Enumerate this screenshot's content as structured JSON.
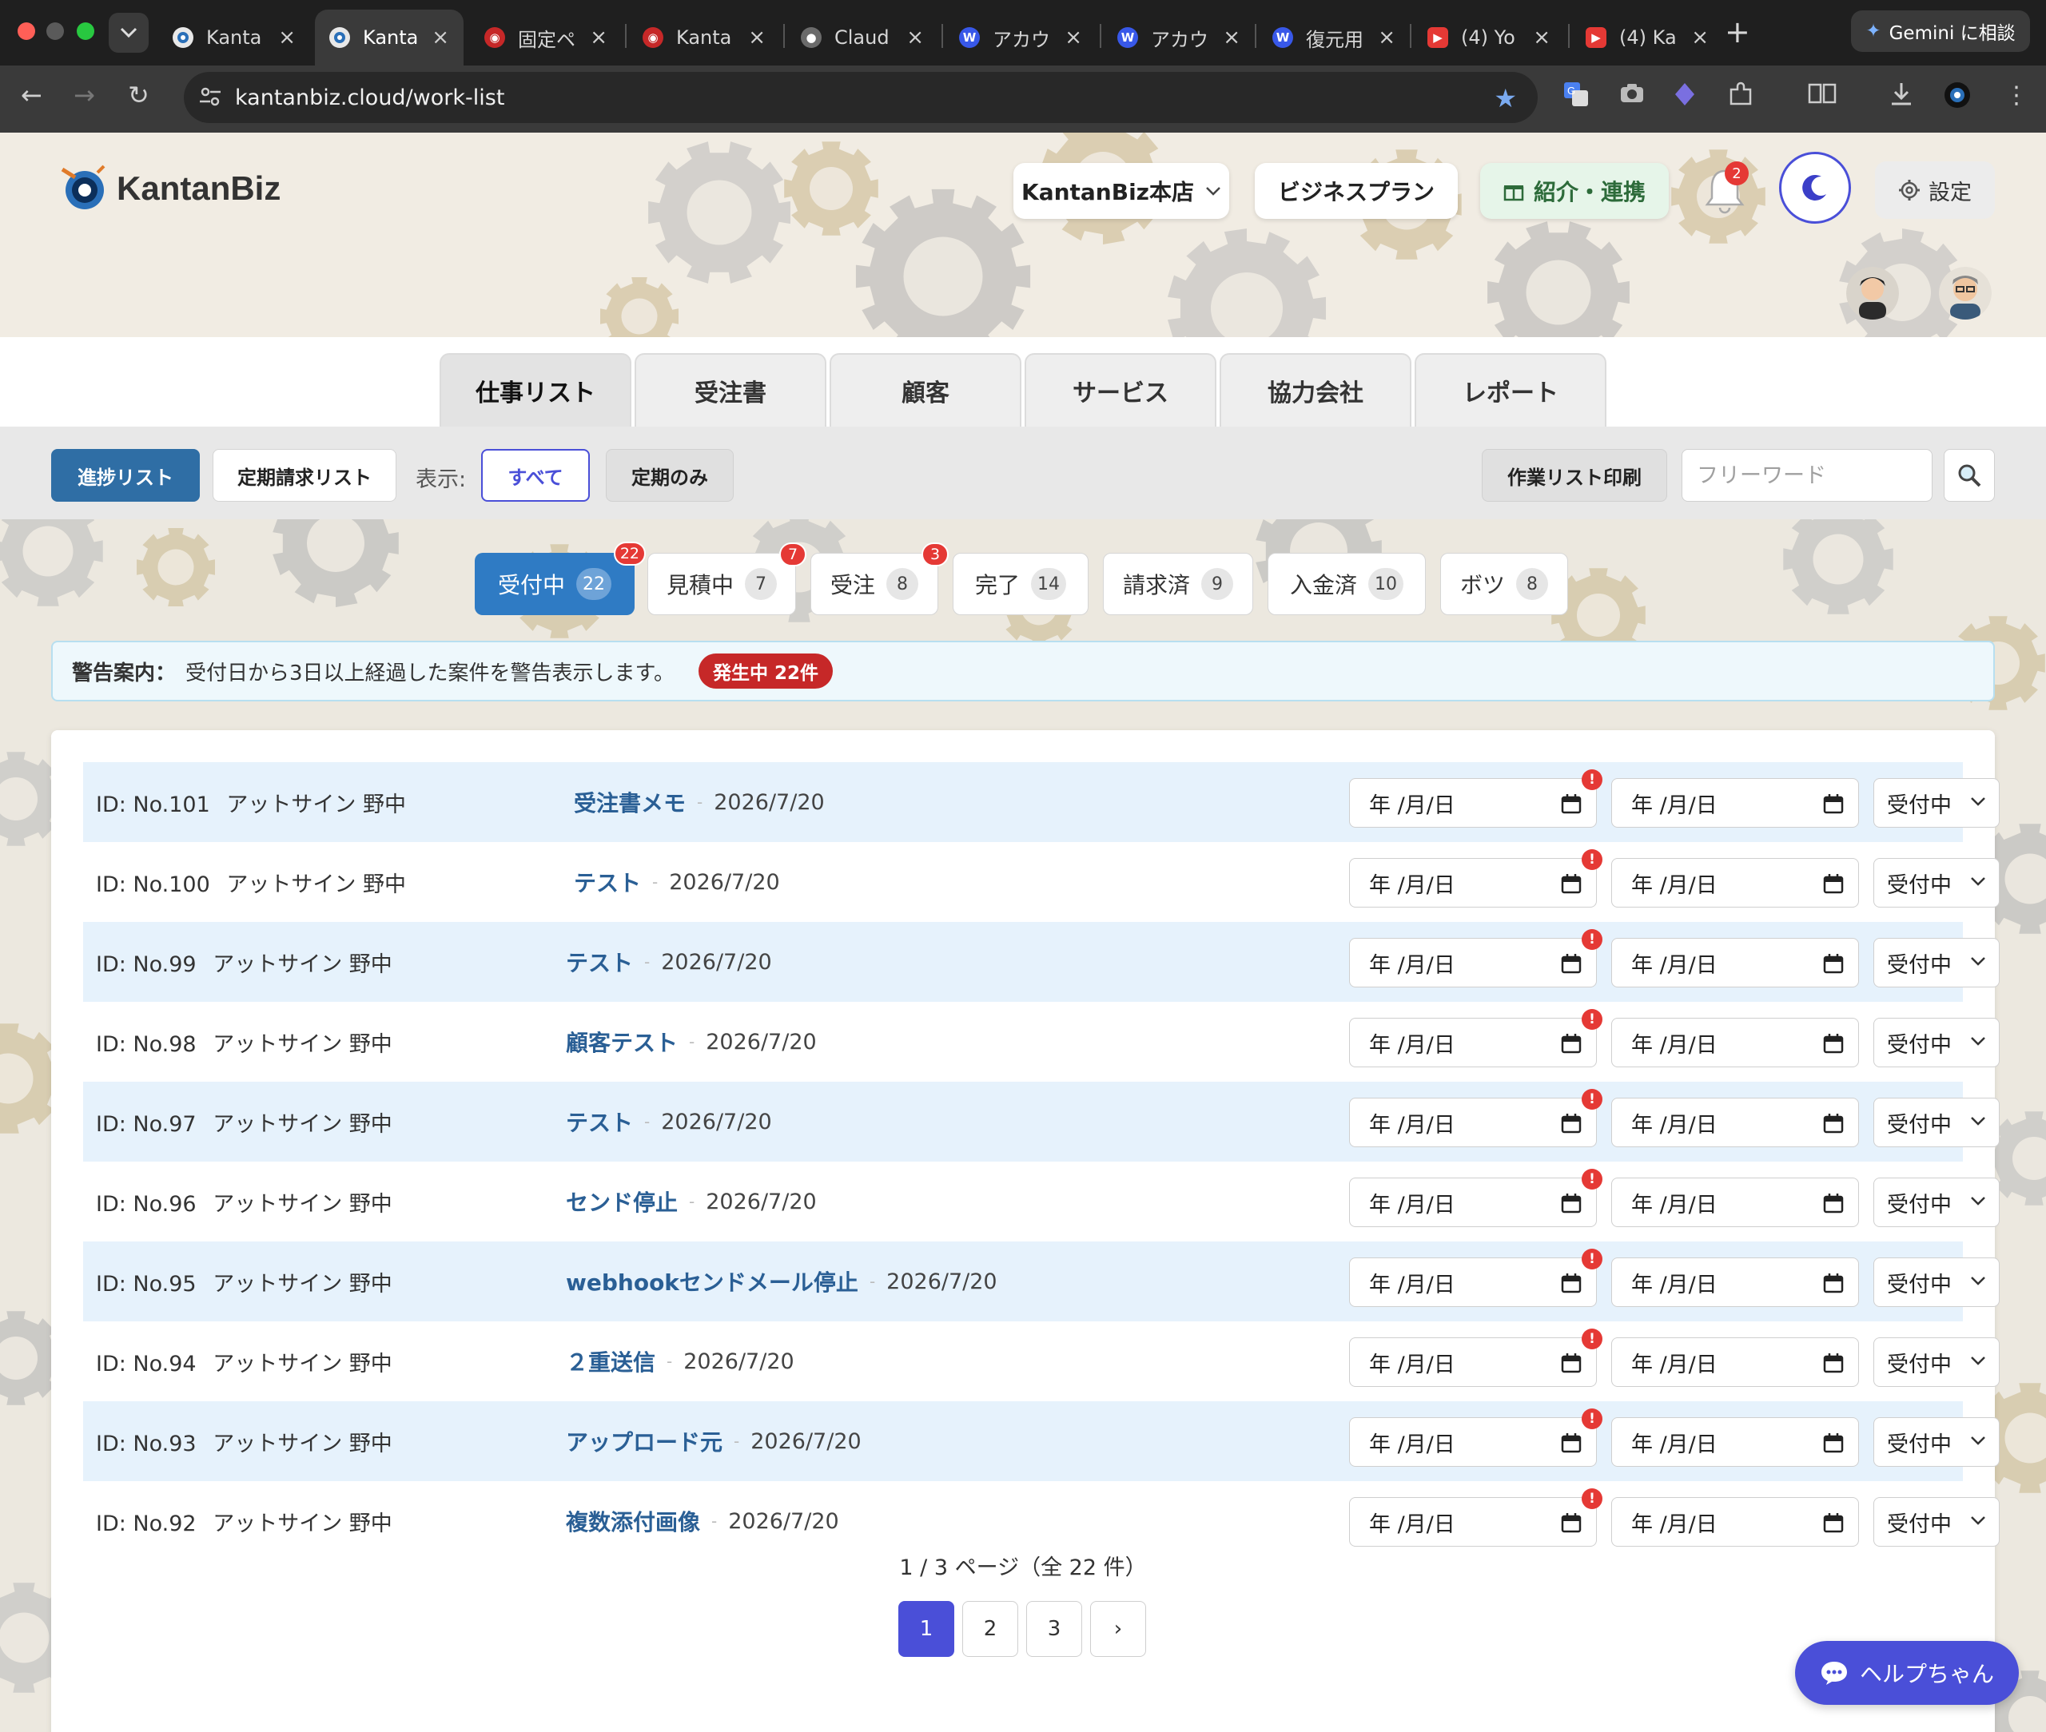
{
  "browser": {
    "tabs": [
      {
        "label": "Kanta",
        "favicon_color": "#3a3a3a",
        "active": false
      },
      {
        "label": "Kanta",
        "favicon_color": "#3a3a3a",
        "active": true
      },
      {
        "label": "固定ペ",
        "favicon_color": "#c62828",
        "active": false
      },
      {
        "label": "Kanta",
        "favicon_color": "#c62828",
        "active": false
      },
      {
        "label": "Claud",
        "favicon_color": "#6b6b6b",
        "active": false
      },
      {
        "label": "アカウ",
        "favicon_color": "#3858e9",
        "active": false
      },
      {
        "label": "アカウ",
        "favicon_color": "#3858e9",
        "active": false
      },
      {
        "label": "復元用",
        "favicon_color": "#3858e9",
        "active": false
      },
      {
        "label": "(4) Yo",
        "favicon_color": "#e53935",
        "active": false
      },
      {
        "label": "(4) Ka",
        "favicon_color": "#e53935",
        "active": false
      }
    ],
    "gemini_label": "Gemini に相談",
    "url": "kantanbiz.cloud/work-list"
  },
  "header": {
    "logo_text": "KantanBiz",
    "store_label": "KantanBiz本店",
    "plan_label": "ビジネスプラン",
    "referral_label": "紹介・連携",
    "notification_count": "2",
    "settings_label": "設定"
  },
  "nav": {
    "tabs": [
      "仕事リスト",
      "受注書",
      "顧客",
      "サービス",
      "協力会社",
      "レポート"
    ]
  },
  "toolbar": {
    "progress_label": "進捗リスト",
    "periodic_label": "定期請求リスト",
    "display_label": "表示:",
    "all_label": "すべて",
    "periodic_only_label": "定期のみ",
    "print_label": "作業リスト印刷",
    "search_placeholder": "フリーワード"
  },
  "status_tabs": [
    {
      "label": "受付中",
      "count": "22",
      "alert": "22"
    },
    {
      "label": "見積中",
      "count": "7",
      "alert": "7"
    },
    {
      "label": "受注",
      "count": "8",
      "alert": "3"
    },
    {
      "label": "完了",
      "count": "14",
      "alert": ""
    },
    {
      "label": "請求済",
      "count": "9",
      "alert": ""
    },
    {
      "label": "入金済",
      "count": "10",
      "alert": ""
    },
    {
      "label": "ボツ",
      "count": "8",
      "alert": ""
    }
  ],
  "warning": {
    "title": "警告案内：",
    "text": "受付日から3日以上経過した案件を警告表示します。",
    "badge": "発生中 22件"
  },
  "rows": [
    {
      "id": "ID: No.101",
      "client": "アットサイン 野中",
      "title": "受注書メモ",
      "date": "2026/7/20",
      "start": "年 /月/日",
      "end": "年 /月/日",
      "status": "受付中"
    },
    {
      "id": "ID: No.100",
      "client": "アットサイン 野中",
      "title": "テスト",
      "date": "2026/7/20",
      "start": "年 /月/日",
      "end": "年 /月/日",
      "status": "受付中"
    },
    {
      "id": "ID: No.99",
      "client": "アットサイン 野中",
      "title": "テスト",
      "date": "2026/7/20",
      "start": "年 /月/日",
      "end": "年 /月/日",
      "status": "受付中"
    },
    {
      "id": "ID: No.98",
      "client": "アットサイン 野中",
      "title": "顧客テスト",
      "date": "2026/7/20",
      "start": "年 /月/日",
      "end": "年 /月/日",
      "status": "受付中"
    },
    {
      "id": "ID: No.97",
      "client": "アットサイン 野中",
      "title": "テスト",
      "date": "2026/7/20",
      "start": "年 /月/日",
      "end": "年 /月/日",
      "status": "受付中"
    },
    {
      "id": "ID: No.96",
      "client": "アットサイン 野中",
      "title": "センド停止",
      "date": "2026/7/20",
      "start": "年 /月/日",
      "end": "年 /月/日",
      "status": "受付中"
    },
    {
      "id": "ID: No.95",
      "client": "アットサイン 野中",
      "title": "webhookセンドメール停止",
      "date": "2026/7/20",
      "start": "年 /月/日",
      "end": "年 /月/日",
      "status": "受付中"
    },
    {
      "id": "ID: No.94",
      "client": "アットサイン 野中",
      "title": "２重送信",
      "date": "2026/7/20",
      "start": "年 /月/日",
      "end": "年 /月/日",
      "status": "受付中"
    },
    {
      "id": "ID: No.93",
      "client": "アットサイン 野中",
      "title": "アップロード元",
      "date": "2026/7/20",
      "start": "年 /月/日",
      "end": "年 /月/日",
      "status": "受付中"
    },
    {
      "id": "ID: No.92",
      "client": "アットサイン 野中",
      "title": "複数添付画像",
      "date": "2026/7/20",
      "start": "年 /月/日",
      "end": "年 /月/日",
      "status": "受付中"
    }
  ],
  "pagination": {
    "info": "1 / 3 ページ（全 22 件）",
    "pages": [
      "1",
      "2",
      "3",
      "›"
    ]
  },
  "help_label": "ヘルプちゃん",
  "colors": {
    "primary": "#2f6ea5",
    "accent": "#4a4fd8",
    "alert": "#e53935",
    "row_alt": "#e6f2fc"
  }
}
